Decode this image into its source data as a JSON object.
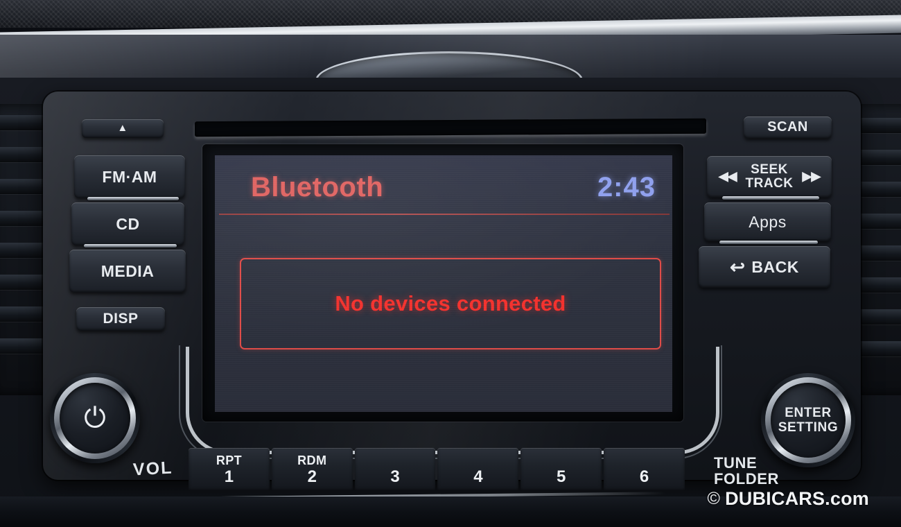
{
  "device": {
    "name": "Nissan car audio head unit",
    "cd_slot_label": "cd-slot"
  },
  "display": {
    "title": "Bluetooth",
    "clock": "2:43",
    "message": "No devices connected",
    "title_color": "#e0615f",
    "clock_color": "#8fa0ee",
    "message_color": "#f3302c",
    "box_border_color": "#e04b47",
    "background_color": "#2e323f"
  },
  "left_buttons": {
    "eject": "▲",
    "fm_am": "FM·AM",
    "cd": "CD",
    "media": "MEDIA",
    "disp": "DISP"
  },
  "right_buttons": {
    "scan": "SCAN",
    "seek_line1": "SEEK",
    "seek_line2": "TRACK",
    "seek_prev": "◀◀",
    "seek_next": "▶▶",
    "apps": "Apps",
    "back": "BACK",
    "back_arrow": "↩"
  },
  "knobs": {
    "volume": {
      "glyph": "⏻",
      "label": "VOL"
    },
    "tune": {
      "face_line1": "ENTER",
      "face_line2": "SETTING",
      "label_line1": "TUNE",
      "label_line2": "FOLDER"
    }
  },
  "presets": [
    {
      "function": "RPT",
      "number": "1"
    },
    {
      "function": "RDM",
      "number": "2"
    },
    {
      "function": "",
      "number": "3"
    },
    {
      "function": "",
      "number": "4"
    },
    {
      "function": "",
      "number": "5"
    },
    {
      "function": "",
      "number": "6"
    }
  ],
  "watermark": {
    "copyright": "©",
    "text": "DUBICARS.com"
  }
}
